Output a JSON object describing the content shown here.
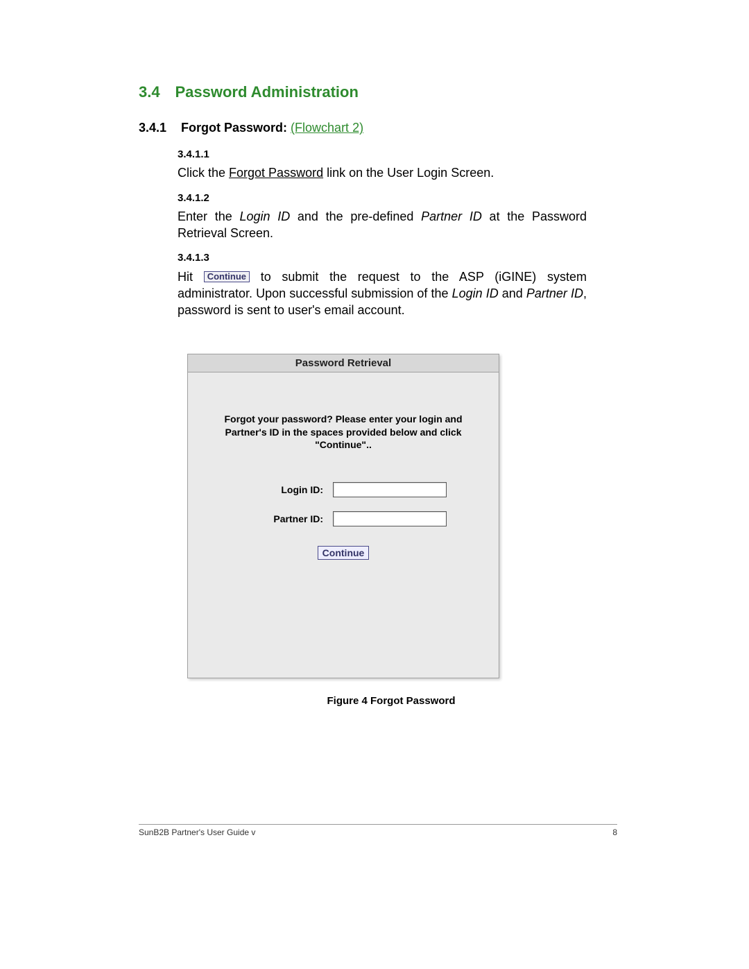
{
  "section": {
    "number": "3.4",
    "title": "Password Administration"
  },
  "subsection": {
    "number": "3.4.1",
    "title": "Forgot Password:",
    "link": "(Flowchart 2)"
  },
  "steps": {
    "s1": {
      "num": "3.4.1.1",
      "pre": "Click the ",
      "underline": "Forgot Password",
      "post": " link on the User Login Screen."
    },
    "s2": {
      "num": "3.4.1.2",
      "a": "Enter the ",
      "i1": "Login ID",
      "b": " and the pre-defined ",
      "i2": "Partner ID",
      "c": " at the Password Retrieval Screen."
    },
    "s3": {
      "num": "3.4.1.3",
      "a": "Hit ",
      "btn": "Continue",
      "b": " to submit the request to the ASP (iGINE) system administrator. Upon successful submission of the ",
      "i1": "Login ID",
      "c": " and ",
      "i2": "Partner ID",
      "d": ", password is sent to user's email account."
    }
  },
  "panel": {
    "title": "Password Retrieval",
    "message1": "Forgot your password? Please enter your login and",
    "message2": "Partner's ID in the spaces provided below and click",
    "message3": "\"Continue\"..",
    "loginLabel": "Login ID:",
    "partnerLabel": "Partner ID:",
    "loginValue": "",
    "partnerValue": "",
    "continue": "Continue"
  },
  "figureCaption": "Figure 4  Forgot Password",
  "footer": {
    "left": "SunB2B Partner's User Guide v",
    "right": "8"
  }
}
